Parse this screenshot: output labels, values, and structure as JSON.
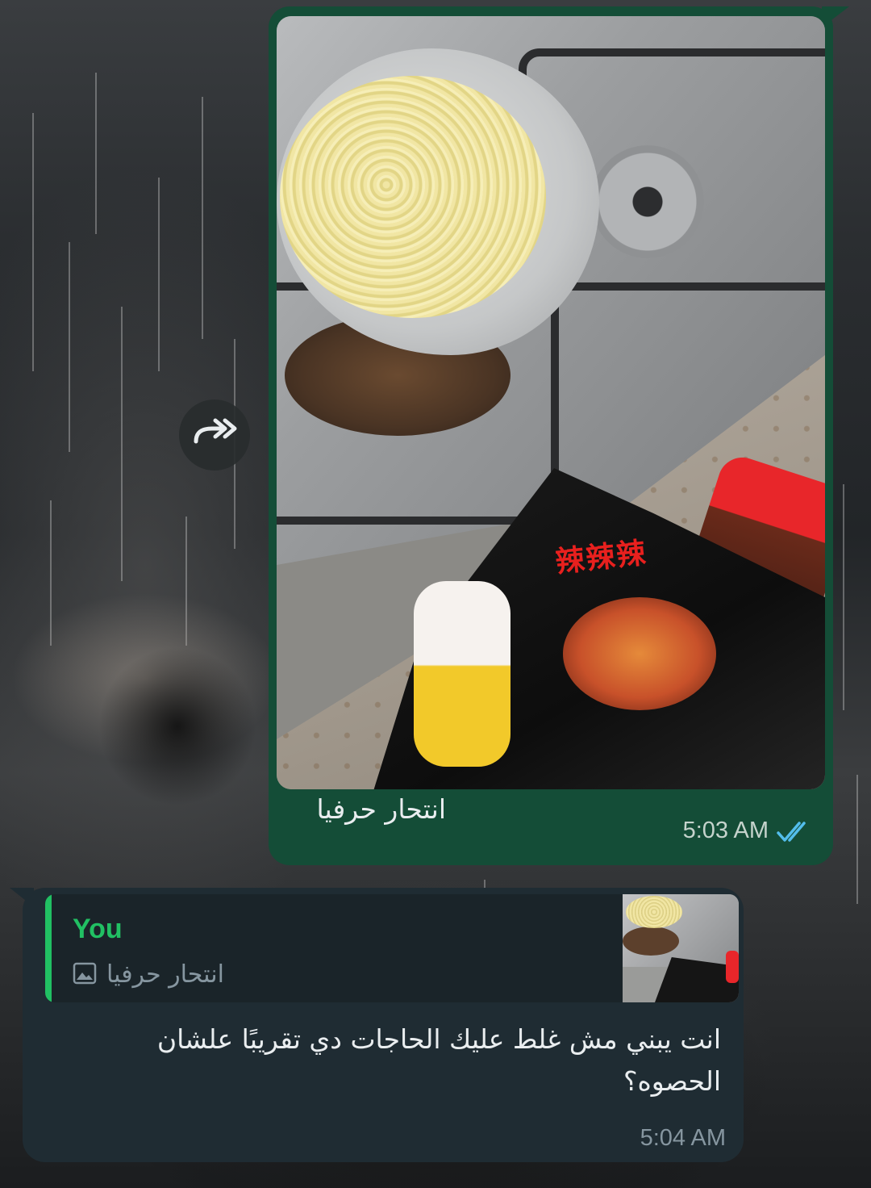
{
  "outgoing_message": {
    "caption": "انتحار حرفيا",
    "time": "5:03 AM",
    "status": "read",
    "status_icon": "double-check-icon",
    "status_color": "#53bdeb",
    "bubble_color": "#144d37",
    "image_packet_text": "辣辣辣"
  },
  "forward_button": {
    "icon": "forward-icon"
  },
  "incoming_message": {
    "reply_to": {
      "author": "You",
      "icon": "image-icon",
      "snippet": "انتحار حرفيا"
    },
    "text": "انت يبني مش غلط عليك الحاجات دي تقريبًا علشان الحصوه؟",
    "time": "5:04 AM",
    "bubble_color": "#1f2c33",
    "accent_color": "#21c063"
  }
}
